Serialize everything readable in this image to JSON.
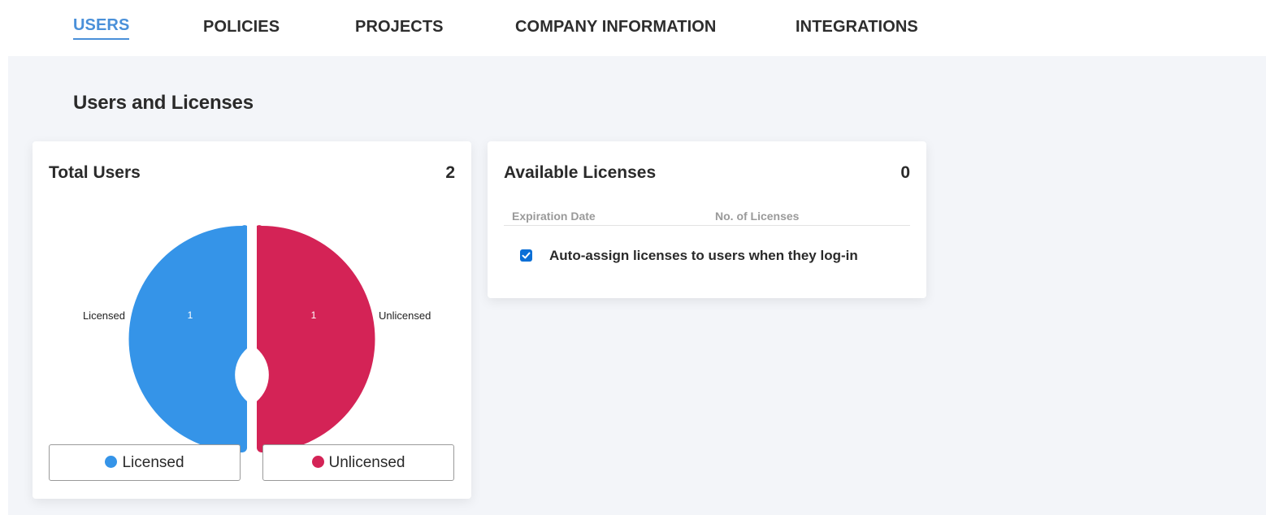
{
  "nav": {
    "tabs": [
      {
        "label": "USERS",
        "active": true
      },
      {
        "label": "POLICIES",
        "active": false
      },
      {
        "label": "PROJECTS",
        "active": false
      },
      {
        "label": "COMPANY INFORMATION",
        "active": false
      },
      {
        "label": "INTEGRATIONS",
        "active": false
      }
    ]
  },
  "section_title": "Users and Licenses",
  "total_users_card": {
    "title": "Total Users",
    "count": "2",
    "chart": {
      "segments": [
        {
          "label": "Licensed",
          "value": 1,
          "color": "#3594e8"
        },
        {
          "label": "Unlicensed",
          "value": 1,
          "color": "#d42356"
        }
      ]
    },
    "legend": [
      {
        "label": "Licensed",
        "color": "#3594e8"
      },
      {
        "label": "Unlicensed",
        "color": "#d42356"
      }
    ]
  },
  "licenses_card": {
    "title": "Available Licenses",
    "count": "0",
    "columns": [
      "Expiration Date",
      "No. of Licenses"
    ],
    "auto_assign": {
      "checked": true,
      "label": "Auto-assign licenses to users when they log-in"
    }
  },
  "colors": {
    "accent": "#4a90d9",
    "licensed": "#3594e8",
    "unlicensed": "#d42356",
    "checkbox": "#0b6fd6"
  }
}
